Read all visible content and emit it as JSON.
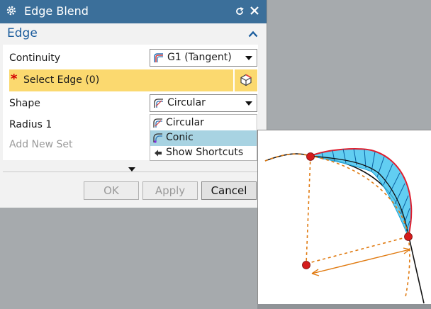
{
  "dialog": {
    "title": "Edge Blend",
    "section_title": "Edge",
    "continuity_label": "Continuity",
    "continuity_value": "G1 (Tangent)",
    "select_edge_label": "Select Edge (0)",
    "required_marker": "*",
    "shape_label": "Shape",
    "shape_value": "Circular",
    "radius_label": "Radius 1",
    "add_new_set_label": "Add New Set",
    "shape_menu": {
      "items": [
        {
          "label": "Circular",
          "icon": "circular-blend-icon"
        },
        {
          "label": "Conic",
          "icon": "conic-blend-icon",
          "highlighted": true
        },
        {
          "label": "Show Shortcuts",
          "icon": "back-arrow-icon"
        }
      ]
    },
    "buttons": {
      "ok": "OK",
      "apply": "Apply",
      "cancel": "Cancel"
    },
    "colors": {
      "titlebar": "#3b6f9a",
      "section_title": "#1c5d9d",
      "selection_highlight": "#fbd96f",
      "menu_highlight": "#a8d3e2",
      "required": "#d40000"
    }
  }
}
